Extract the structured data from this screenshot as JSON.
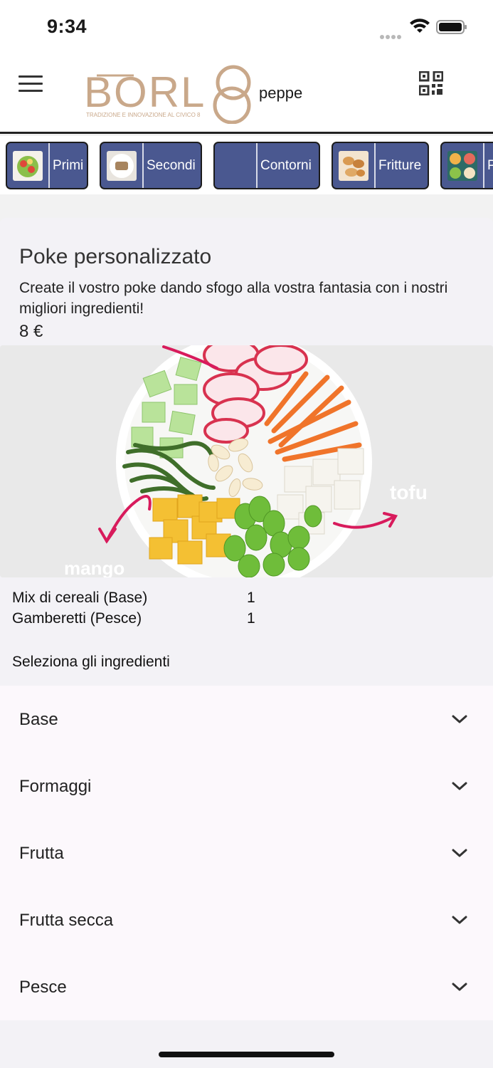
{
  "status_bar": {
    "time": "9:34"
  },
  "header": {
    "logo_text": "BORL8",
    "logo_tagline": "TRADIZIONE E INNOVAZIONE AL CIVICO 8",
    "user_name": "peppe"
  },
  "categories": [
    {
      "label": "Primi",
      "thumb": "salad-thumbnail"
    },
    {
      "label": "Secondi",
      "thumb": "plate-thumbnail"
    },
    {
      "label": "Contorni",
      "thumb": "empty"
    },
    {
      "label": "Fritture",
      "thumb": "fried-food-thumbnail"
    },
    {
      "label": "P",
      "thumb": "poke-bowls-thumbnail"
    }
  ],
  "product": {
    "title": "Poke personalizzato",
    "description": "Create il vostro poke dando sfogo alla vostra fantasia con i nostri migliori ingredienti!",
    "price": "8 €",
    "image_labels": {
      "left": "mango",
      "right": "tofu"
    }
  },
  "selected_ingredients": [
    {
      "name": "Mix di cereali (Base)",
      "qty": "1"
    },
    {
      "name": "Gamberetti (Pesce)",
      "qty": "1"
    }
  ],
  "select_hint": "Seleziona gli ingredienti",
  "ingredient_groups": [
    {
      "label": "Base"
    },
    {
      "label": "Formaggi"
    },
    {
      "label": "Frutta"
    },
    {
      "label": "Frutta secca"
    },
    {
      "label": "Pesce"
    }
  ],
  "colors": {
    "category_bg": "#4a5890",
    "logo": "#c9a88a",
    "accordion_bg": "#fcf8fc"
  }
}
